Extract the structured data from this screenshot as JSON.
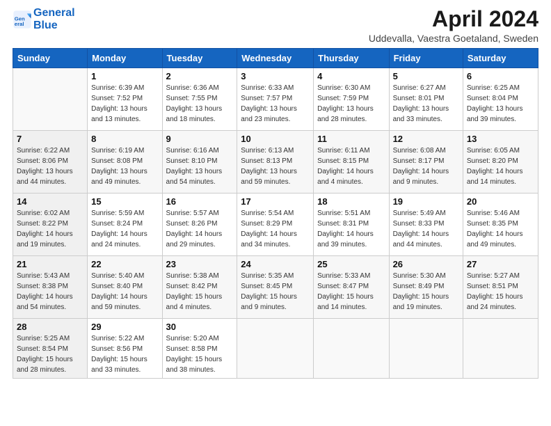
{
  "header": {
    "logo_line1": "General",
    "logo_line2": "Blue",
    "month_title": "April 2024",
    "location": "Uddevalla, Vaestra Goetaland, Sweden"
  },
  "days_of_week": [
    "Sunday",
    "Monday",
    "Tuesday",
    "Wednesday",
    "Thursday",
    "Friday",
    "Saturday"
  ],
  "weeks": [
    [
      {
        "day": "",
        "info": ""
      },
      {
        "day": "1",
        "info": "Sunrise: 6:39 AM\nSunset: 7:52 PM\nDaylight: 13 hours\nand 13 minutes."
      },
      {
        "day": "2",
        "info": "Sunrise: 6:36 AM\nSunset: 7:55 PM\nDaylight: 13 hours\nand 18 minutes."
      },
      {
        "day": "3",
        "info": "Sunrise: 6:33 AM\nSunset: 7:57 PM\nDaylight: 13 hours\nand 23 minutes."
      },
      {
        "day": "4",
        "info": "Sunrise: 6:30 AM\nSunset: 7:59 PM\nDaylight: 13 hours\nand 28 minutes."
      },
      {
        "day": "5",
        "info": "Sunrise: 6:27 AM\nSunset: 8:01 PM\nDaylight: 13 hours\nand 33 minutes."
      },
      {
        "day": "6",
        "info": "Sunrise: 6:25 AM\nSunset: 8:04 PM\nDaylight: 13 hours\nand 39 minutes."
      }
    ],
    [
      {
        "day": "7",
        "info": "Sunrise: 6:22 AM\nSunset: 8:06 PM\nDaylight: 13 hours\nand 44 minutes."
      },
      {
        "day": "8",
        "info": "Sunrise: 6:19 AM\nSunset: 8:08 PM\nDaylight: 13 hours\nand 49 minutes."
      },
      {
        "day": "9",
        "info": "Sunrise: 6:16 AM\nSunset: 8:10 PM\nDaylight: 13 hours\nand 54 minutes."
      },
      {
        "day": "10",
        "info": "Sunrise: 6:13 AM\nSunset: 8:13 PM\nDaylight: 13 hours\nand 59 minutes."
      },
      {
        "day": "11",
        "info": "Sunrise: 6:11 AM\nSunset: 8:15 PM\nDaylight: 14 hours\nand 4 minutes."
      },
      {
        "day": "12",
        "info": "Sunrise: 6:08 AM\nSunset: 8:17 PM\nDaylight: 14 hours\nand 9 minutes."
      },
      {
        "day": "13",
        "info": "Sunrise: 6:05 AM\nSunset: 8:20 PM\nDaylight: 14 hours\nand 14 minutes."
      }
    ],
    [
      {
        "day": "14",
        "info": "Sunrise: 6:02 AM\nSunset: 8:22 PM\nDaylight: 14 hours\nand 19 minutes."
      },
      {
        "day": "15",
        "info": "Sunrise: 5:59 AM\nSunset: 8:24 PM\nDaylight: 14 hours\nand 24 minutes."
      },
      {
        "day": "16",
        "info": "Sunrise: 5:57 AM\nSunset: 8:26 PM\nDaylight: 14 hours\nand 29 minutes."
      },
      {
        "day": "17",
        "info": "Sunrise: 5:54 AM\nSunset: 8:29 PM\nDaylight: 14 hours\nand 34 minutes."
      },
      {
        "day": "18",
        "info": "Sunrise: 5:51 AM\nSunset: 8:31 PM\nDaylight: 14 hours\nand 39 minutes."
      },
      {
        "day": "19",
        "info": "Sunrise: 5:49 AM\nSunset: 8:33 PM\nDaylight: 14 hours\nand 44 minutes."
      },
      {
        "day": "20",
        "info": "Sunrise: 5:46 AM\nSunset: 8:35 PM\nDaylight: 14 hours\nand 49 minutes."
      }
    ],
    [
      {
        "day": "21",
        "info": "Sunrise: 5:43 AM\nSunset: 8:38 PM\nDaylight: 14 hours\nand 54 minutes."
      },
      {
        "day": "22",
        "info": "Sunrise: 5:40 AM\nSunset: 8:40 PM\nDaylight: 14 hours\nand 59 minutes."
      },
      {
        "day": "23",
        "info": "Sunrise: 5:38 AM\nSunset: 8:42 PM\nDaylight: 15 hours\nand 4 minutes."
      },
      {
        "day": "24",
        "info": "Sunrise: 5:35 AM\nSunset: 8:45 PM\nDaylight: 15 hours\nand 9 minutes."
      },
      {
        "day": "25",
        "info": "Sunrise: 5:33 AM\nSunset: 8:47 PM\nDaylight: 15 hours\nand 14 minutes."
      },
      {
        "day": "26",
        "info": "Sunrise: 5:30 AM\nSunset: 8:49 PM\nDaylight: 15 hours\nand 19 minutes."
      },
      {
        "day": "27",
        "info": "Sunrise: 5:27 AM\nSunset: 8:51 PM\nDaylight: 15 hours\nand 24 minutes."
      }
    ],
    [
      {
        "day": "28",
        "info": "Sunrise: 5:25 AM\nSunset: 8:54 PM\nDaylight: 15 hours\nand 28 minutes."
      },
      {
        "day": "29",
        "info": "Sunrise: 5:22 AM\nSunset: 8:56 PM\nDaylight: 15 hours\nand 33 minutes."
      },
      {
        "day": "30",
        "info": "Sunrise: 5:20 AM\nSunset: 8:58 PM\nDaylight: 15 hours\nand 38 minutes."
      },
      {
        "day": "",
        "info": ""
      },
      {
        "day": "",
        "info": ""
      },
      {
        "day": "",
        "info": ""
      },
      {
        "day": "",
        "info": ""
      }
    ]
  ]
}
